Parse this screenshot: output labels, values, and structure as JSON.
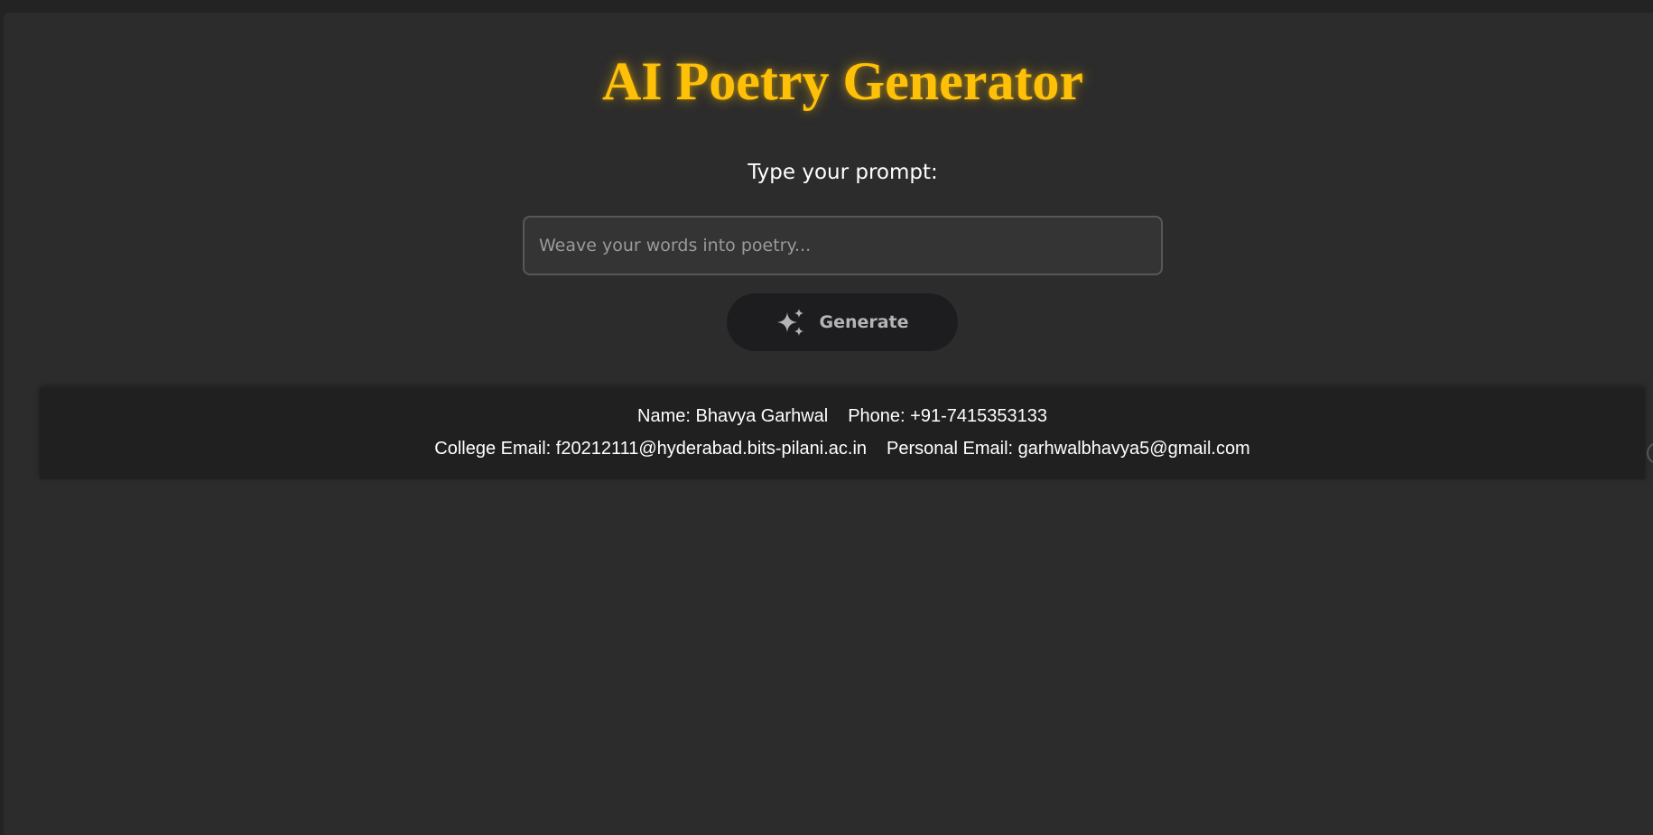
{
  "header": {
    "title": "AI Poetry Generator"
  },
  "prompt": {
    "label": "Type your prompt:",
    "value": "",
    "placeholder": "Weave your words into poetry..."
  },
  "actions": {
    "generate_label": "Generate",
    "generate_icon": "sparkle-icon"
  },
  "footer": {
    "name": "Name: Bhavya Garhwal",
    "phone": "Phone: +91-7415353133",
    "college_email": "College Email: f20212111@hyderabad.bits-pilani.ac.in",
    "personal_email": "Personal Email: garhwalbhavya5@gmail.com"
  },
  "colors": {
    "accent": "#ffc107",
    "background": "#2c2c2c",
    "footer_background": "#202020",
    "button_background": "#1d1d1f"
  }
}
